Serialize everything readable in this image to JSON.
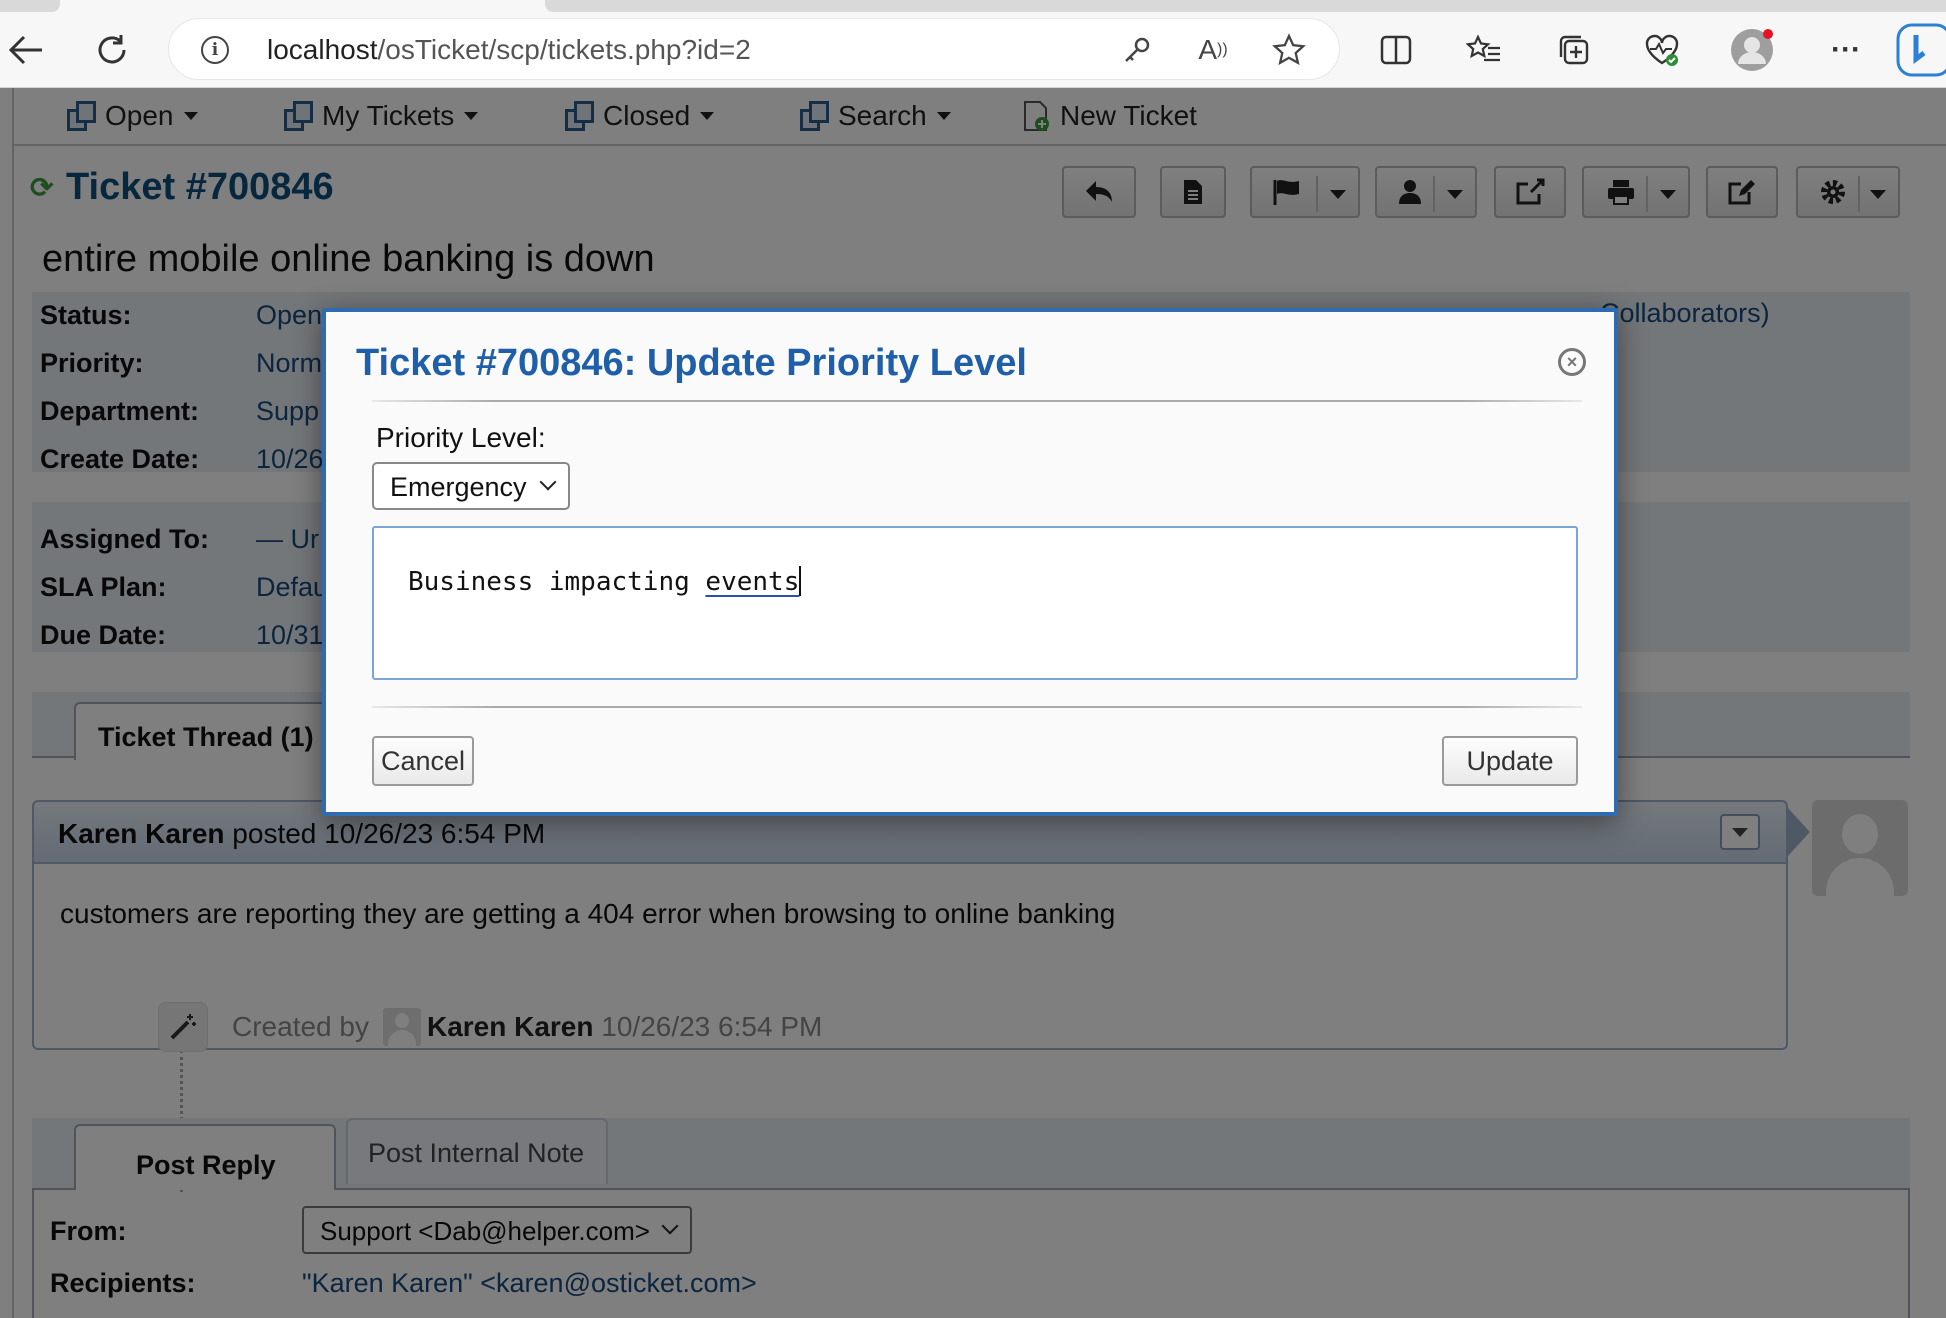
{
  "browser": {
    "url_host": "localhost",
    "url_path": "/osTicket/scp/tickets.php?id=2"
  },
  "nav": {
    "open": "Open",
    "my_tickets": "My Tickets",
    "closed": "Closed",
    "search": "Search",
    "new_ticket": "New Ticket"
  },
  "ticket": {
    "title": "Ticket #700846",
    "subject": "entire mobile online banking is down",
    "collaborators_fragment": "Collaborators)"
  },
  "info": {
    "status_label": "Status:",
    "status_val": "Open",
    "priority_label": "Priority:",
    "priority_val": "Norm",
    "department_label": "Department:",
    "department_val": "Supp",
    "create_label": "Create Date:",
    "create_val": "10/26",
    "assigned_label": "Assigned To:",
    "assigned_val": "— Ur",
    "sla_label": "SLA Plan:",
    "sla_val": "Defau",
    "due_label": "Due Date:",
    "due_val": "10/31"
  },
  "thread": {
    "tab_label": "Ticket Thread (1)",
    "poster": "Karen Karen",
    "posted_text": "posted 10/26/23 6:54 PM",
    "message": "customers are reporting they are getting a 404 error when browsing to online banking",
    "event_prefix": "Created by",
    "event_user": "Karen Karen",
    "event_time": "10/26/23 6:54 PM"
  },
  "reply": {
    "post_reply_tab": "Post Reply",
    "internal_note_tab": "Post Internal Note",
    "from_label": "From:",
    "from_value": "Support <Dab@helper.com>",
    "recipients_label": "Recipients:",
    "recipients_value": "\"Karen Karen\" <karen@osticket.com>"
  },
  "modal": {
    "title": "Ticket #700846: Update Priority Level",
    "priority_label": "Priority Level:",
    "priority_selected": "Emergency",
    "note_text_plain": "Business impacting ",
    "note_text_spell": "events",
    "cancel_label": "Cancel",
    "update_label": "Update"
  }
}
